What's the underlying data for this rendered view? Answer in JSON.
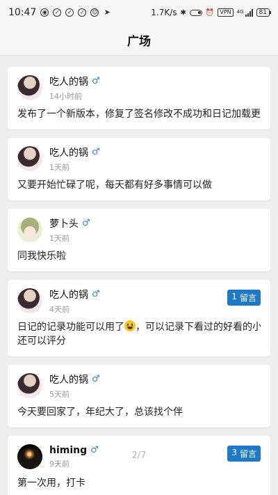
{
  "status_bar": {
    "time": "10:47",
    "net_speed": "1.7K/s",
    "vpn": "VPN",
    "signal_label": "4G",
    "battery": "81",
    "left_icons": [
      "weibo-icon",
      "check-icon",
      "check-icon",
      "check-icon",
      "mi-icon",
      "send-icon"
    ],
    "right_icons": [
      "bluetooth-icon",
      "toggle-icon",
      "alarm-icon",
      "vpn-icon",
      "signal-icon",
      "battery-icon"
    ]
  },
  "header": {
    "title": "广场"
  },
  "posts": [
    {
      "username": "吃人的锅",
      "gender": "♂",
      "time": "14小时前",
      "content": "发布了一个新版本，修复了签名修改不成功和日记加载更多"
    },
    {
      "username": "吃人的锅",
      "gender": "♂",
      "time": "1天前",
      "content": "又要开始忙碌了呢，每天都有好多事情可以做"
    },
    {
      "username": "萝卜头",
      "gender": "♂",
      "time": "1天前",
      "content": "同我快乐啦"
    },
    {
      "username": "吃人的锅",
      "gender": "♂",
      "time": "4天前",
      "content_before_emoji": "日记的记录功能可以用了",
      "content_after_emoji": "，可以记录下看过的好看的小",
      "content_line2": "还可以评分",
      "comment_count": "1",
      "comment_label": "留言"
    },
    {
      "username": "吃人的锅",
      "gender": "♂",
      "time": "5天前",
      "content": "今天要回家了，年纪大了，总该找个伴"
    },
    {
      "username": "himing",
      "gender": "♂",
      "time": "9天前",
      "content": "第一次用，打卡",
      "comment_count": "3",
      "comment_label": "留言"
    }
  ],
  "page_indicator": "2/7",
  "colors": {
    "accent": "#1e79c8",
    "gender": "#2f86d6",
    "background": "#eeeeee"
  }
}
